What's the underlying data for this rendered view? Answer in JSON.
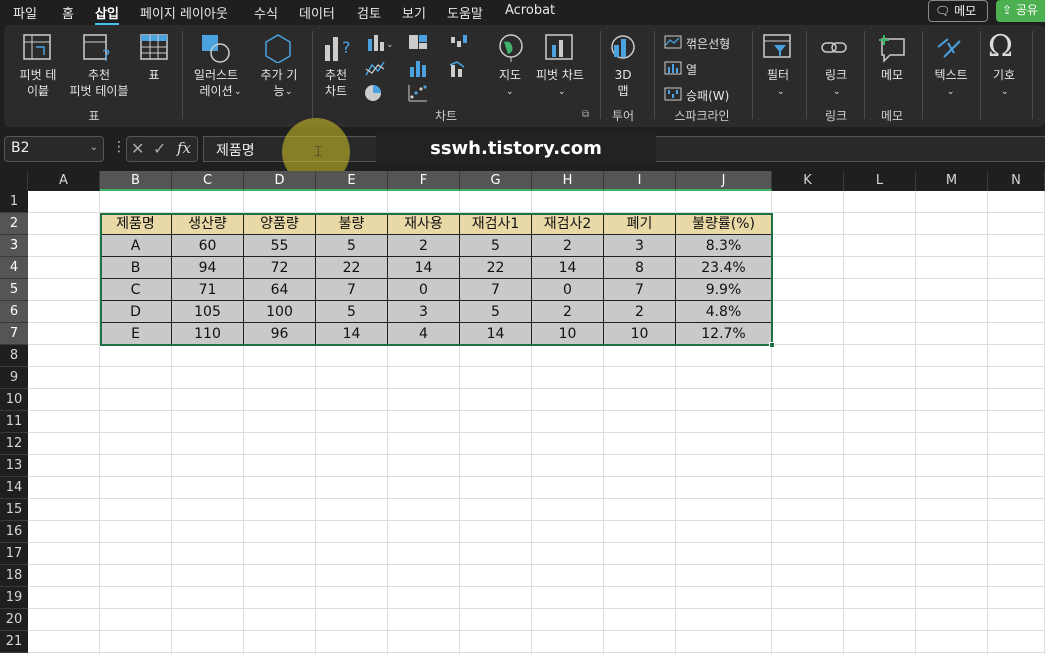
{
  "menu": {
    "tabs": [
      "파일",
      "홈",
      "삽입",
      "페이지 레이아웃",
      "수식",
      "데이터",
      "검토",
      "보기",
      "도움말",
      "Acrobat"
    ],
    "memo_btn": "메모",
    "share_btn": "공유"
  },
  "ribbon": {
    "pivot": "피벗 테\n이블",
    "rec_pivot": "추천\n피벗 테이블",
    "table": "표",
    "group_table": "표",
    "illustration": "일러스트\n레이션",
    "addin": "추가 기\n능",
    "rec_chart": "추천\n차트",
    "map": "지도",
    "pivot_chart": "피벗 차트",
    "group_chart": "차트",
    "map3d": "3D\n맵",
    "group_tour": "투어",
    "spark_line": "꺾은선형",
    "spark_col": "열",
    "spark_winloss": "승패(W)",
    "group_spark": "스파크라인",
    "filter": "필터",
    "link": "링크",
    "group_link": "링크",
    "memo": "메모",
    "group_memo": "메모",
    "text": "텍스트",
    "symbol": "기호"
  },
  "formula_bar": {
    "name_box": "B2",
    "value": "제품명"
  },
  "watermark": "sswh.tistory.com",
  "grid": {
    "columns": [
      "A",
      "B",
      "C",
      "D",
      "E",
      "F",
      "G",
      "H",
      "I",
      "J",
      "K",
      "L",
      "M",
      "N"
    ],
    "rows": [
      "1",
      "2",
      "3",
      "4",
      "5",
      "6",
      "7",
      "8",
      "9",
      "10",
      "11",
      "12",
      "13",
      "14",
      "15",
      "16",
      "17",
      "18",
      "19",
      "20",
      "21"
    ]
  },
  "table": {
    "headers": [
      "제품명",
      "생산량",
      "양품량",
      "불량",
      "재사용",
      "재검사1",
      "재검사2",
      "폐기",
      "불량률(%)"
    ],
    "rows": [
      [
        "A",
        "60",
        "55",
        "5",
        "2",
        "5",
        "2",
        "3",
        "8.3%"
      ],
      [
        "B",
        "94",
        "72",
        "22",
        "14",
        "22",
        "14",
        "8",
        "23.4%"
      ],
      [
        "C",
        "71",
        "64",
        "7",
        "0",
        "7",
        "0",
        "7",
        "9.9%"
      ],
      [
        "D",
        "105",
        "100",
        "5",
        "3",
        "5",
        "2",
        "2",
        "4.8%"
      ],
      [
        "E",
        "110",
        "96",
        "14",
        "4",
        "14",
        "10",
        "10",
        "12.7%"
      ]
    ]
  },
  "colors": {
    "header_fill": "#e9d9a6",
    "cell_fill": "#c9c9c9",
    "selection": "#1e7145",
    "accent": "#49c0f5"
  }
}
